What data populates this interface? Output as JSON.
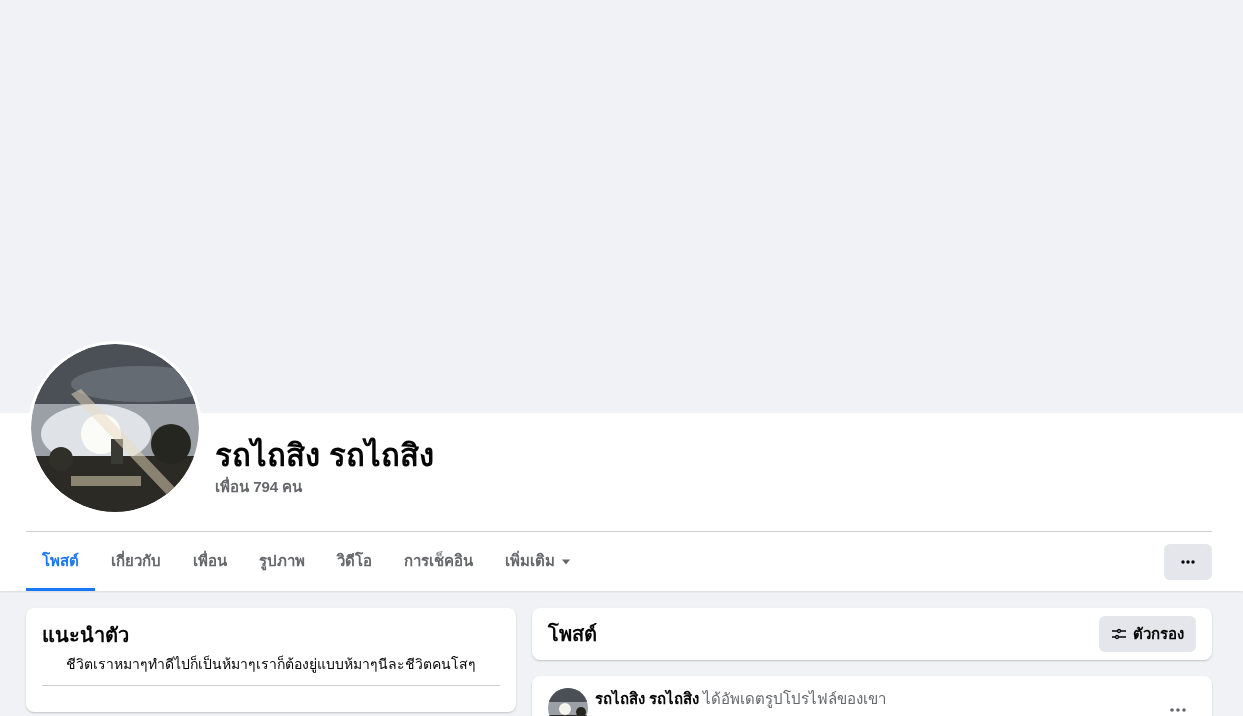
{
  "profile": {
    "name": "รถไถสิง รถไถสิง",
    "friends": "เพื่อน 794 คน"
  },
  "tabs": [
    {
      "label": "โพสต์",
      "selected": true
    },
    {
      "label": "เกี่ยวกับ",
      "selected": false
    },
    {
      "label": "เพื่อน",
      "selected": false
    },
    {
      "label": "รูปภาพ",
      "selected": false
    },
    {
      "label": "วิดีโอ",
      "selected": false
    },
    {
      "label": "การเช็คอิน",
      "selected": false
    },
    {
      "label": "เพิ่มเติม",
      "selected": false,
      "dropdown": true
    }
  ],
  "intro": {
    "title": "แนะนำตัว",
    "bio": "ชีวิตเราหมาๆทำดีไปก็เป็นห้มาๆเราก็ต้องยู่แบบห้มาๆนีละชีวิตคนโสๆ"
  },
  "posts_header": {
    "title": "โพสต์",
    "filter_button": "ตัวกรอง"
  },
  "post": {
    "author": "รถไถสิง รถไถสิง",
    "action": "ได้อัพเดตรูปโปรไฟล์ของเขา"
  }
}
